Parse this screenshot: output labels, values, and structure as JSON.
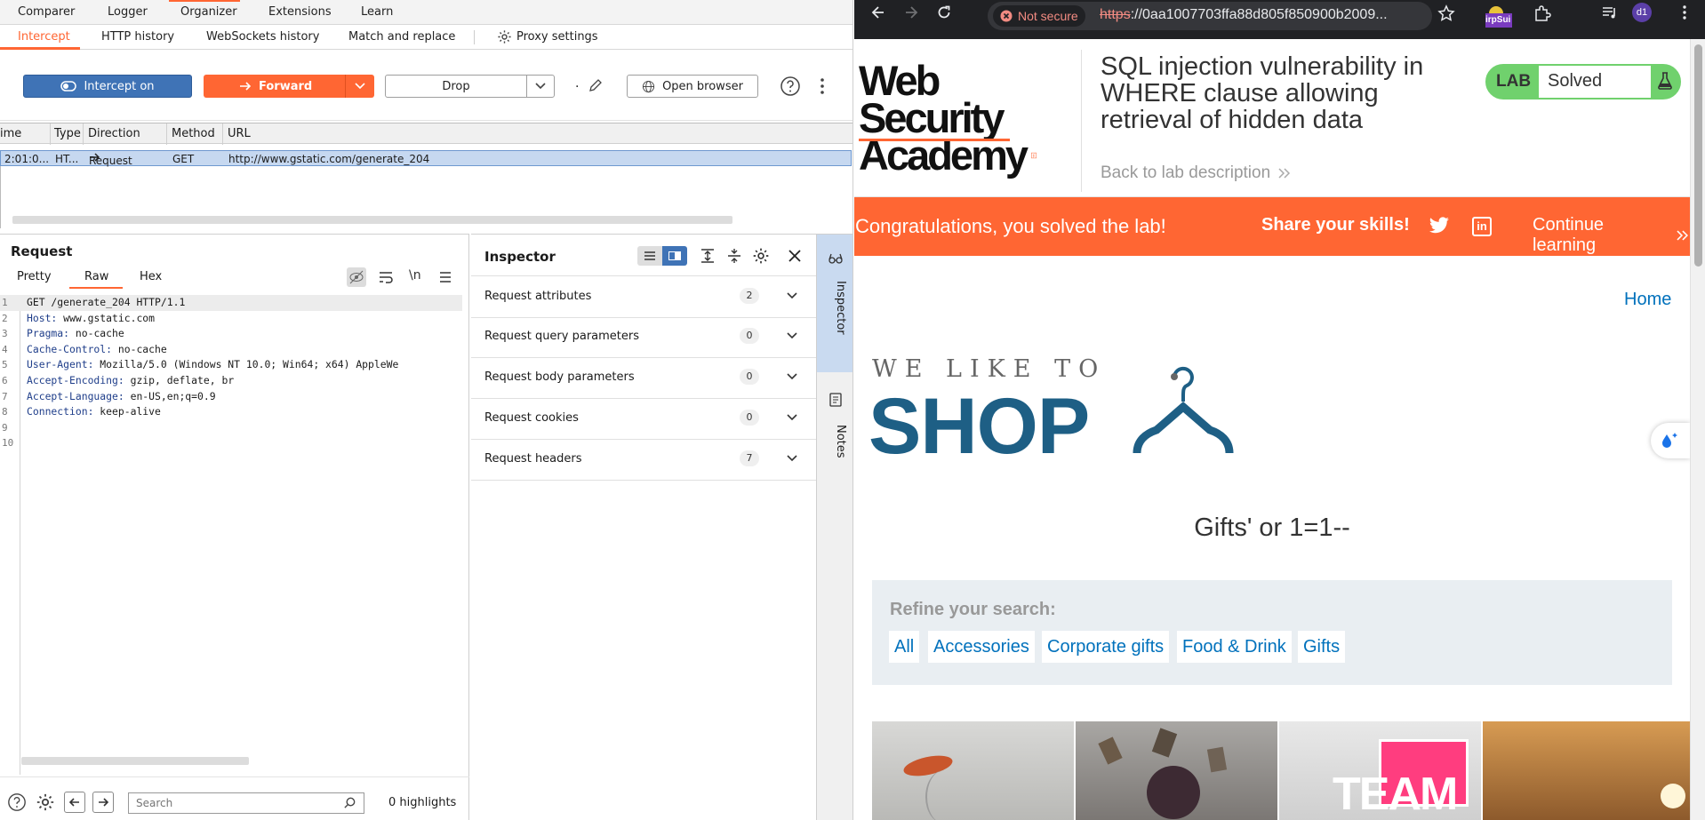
{
  "burp": {
    "top_tabs": [
      "Comparer",
      "Logger",
      "Organizer",
      "Extensions",
      "Learn"
    ],
    "sub_tabs": [
      "Intercept",
      "HTTP history",
      "WebSockets history",
      "Match and replace",
      "Proxy settings"
    ],
    "active_sub_tab": "Intercept",
    "toolbar": {
      "intercept_label": "Intercept on",
      "forward_label": "Forward",
      "drop_label": "Drop",
      "dot": ".",
      "open_browser_label": "Open browser"
    },
    "history": {
      "columns": [
        "ime",
        "Type",
        "Direction",
        "Method",
        "URL"
      ],
      "row": {
        "time": "2:01:0...",
        "type": "HT...",
        "direction": "Request",
        "method": "GET",
        "url": "http://www.gstatic.com/generate_204"
      }
    },
    "request": {
      "title": "Request",
      "tabs": [
        "Pretty",
        "Raw",
        "Hex"
      ],
      "active_tab": "Raw",
      "newline_label": "\\n",
      "lines": [
        {
          "n": "1",
          "key": "",
          "val": "GET /generate_204 HTTP/1.1"
        },
        {
          "n": "2",
          "key": "Host:",
          "val": " www.gstatic.com"
        },
        {
          "n": "3",
          "key": "Pragma:",
          "val": " no-cache"
        },
        {
          "n": "4",
          "key": "Cache-Control:",
          "val": " no-cache"
        },
        {
          "n": "5",
          "key": "User-Agent:",
          "val": " Mozilla/5.0 (Windows NT 10.0; Win64; x64) AppleWe"
        },
        {
          "n": "6",
          "key": "Accept-Encoding:",
          "val": " gzip, deflate, br"
        },
        {
          "n": "7",
          "key": "Accept-Language:",
          "val": " en-US,en;q=0.9"
        },
        {
          "n": "8",
          "key": "Connection:",
          "val": " keep-alive"
        },
        {
          "n": "9",
          "key": "",
          "val": ""
        },
        {
          "n": "10",
          "key": "",
          "val": ""
        }
      ],
      "search_placeholder": "Search",
      "highlights": "0 highlights"
    },
    "inspector": {
      "title": "Inspector",
      "rows": [
        {
          "label": "Request attributes",
          "count": "2"
        },
        {
          "label": "Request query parameters",
          "count": "0"
        },
        {
          "label": "Request body parameters",
          "count": "0"
        },
        {
          "label": "Request cookies",
          "count": "0"
        },
        {
          "label": "Request headers",
          "count": "7"
        }
      ],
      "side_tabs": [
        "Inspector",
        "Notes"
      ]
    }
  },
  "browser": {
    "not_secure": "Not secure",
    "url_scheme": "https",
    "url_rest": "://0aa1007703ffa88d805f850900b2009...",
    "ext_label": "irpSui",
    "profile": "d1",
    "lab": {
      "logo_line1": "Web Security",
      "logo_line2": "Academy",
      "title": "SQL injection vulnerability in WHERE clause allowing retrieval of hidden data",
      "title_lines": [
        "SQL injection vulnerability in",
        "WHERE clause allowing",
        "retrieval of hidden data"
      ],
      "back_link": "Back to lab description",
      "badge_label": "LAB",
      "status": "Solved"
    },
    "banner": {
      "congrats": "Congratulations, you solved the lab!",
      "share": "Share your skills!",
      "continue": "Continue learning"
    },
    "shop": {
      "home_link": "Home",
      "tagline": "WE LIKE TO",
      "brand": "SHOP",
      "search_heading": "Gifts' or 1=1--",
      "refine_label": "Refine your search:",
      "categories": [
        "All",
        "Accessories",
        "Corporate gifts",
        "Food & Drink",
        "Gifts"
      ],
      "tile_text": "TEAM"
    },
    "colors": {
      "accent": "#ff6633",
      "link": "#0071bc",
      "lab_green": "#70d16d",
      "shop_blue": "#1e5f85"
    }
  }
}
